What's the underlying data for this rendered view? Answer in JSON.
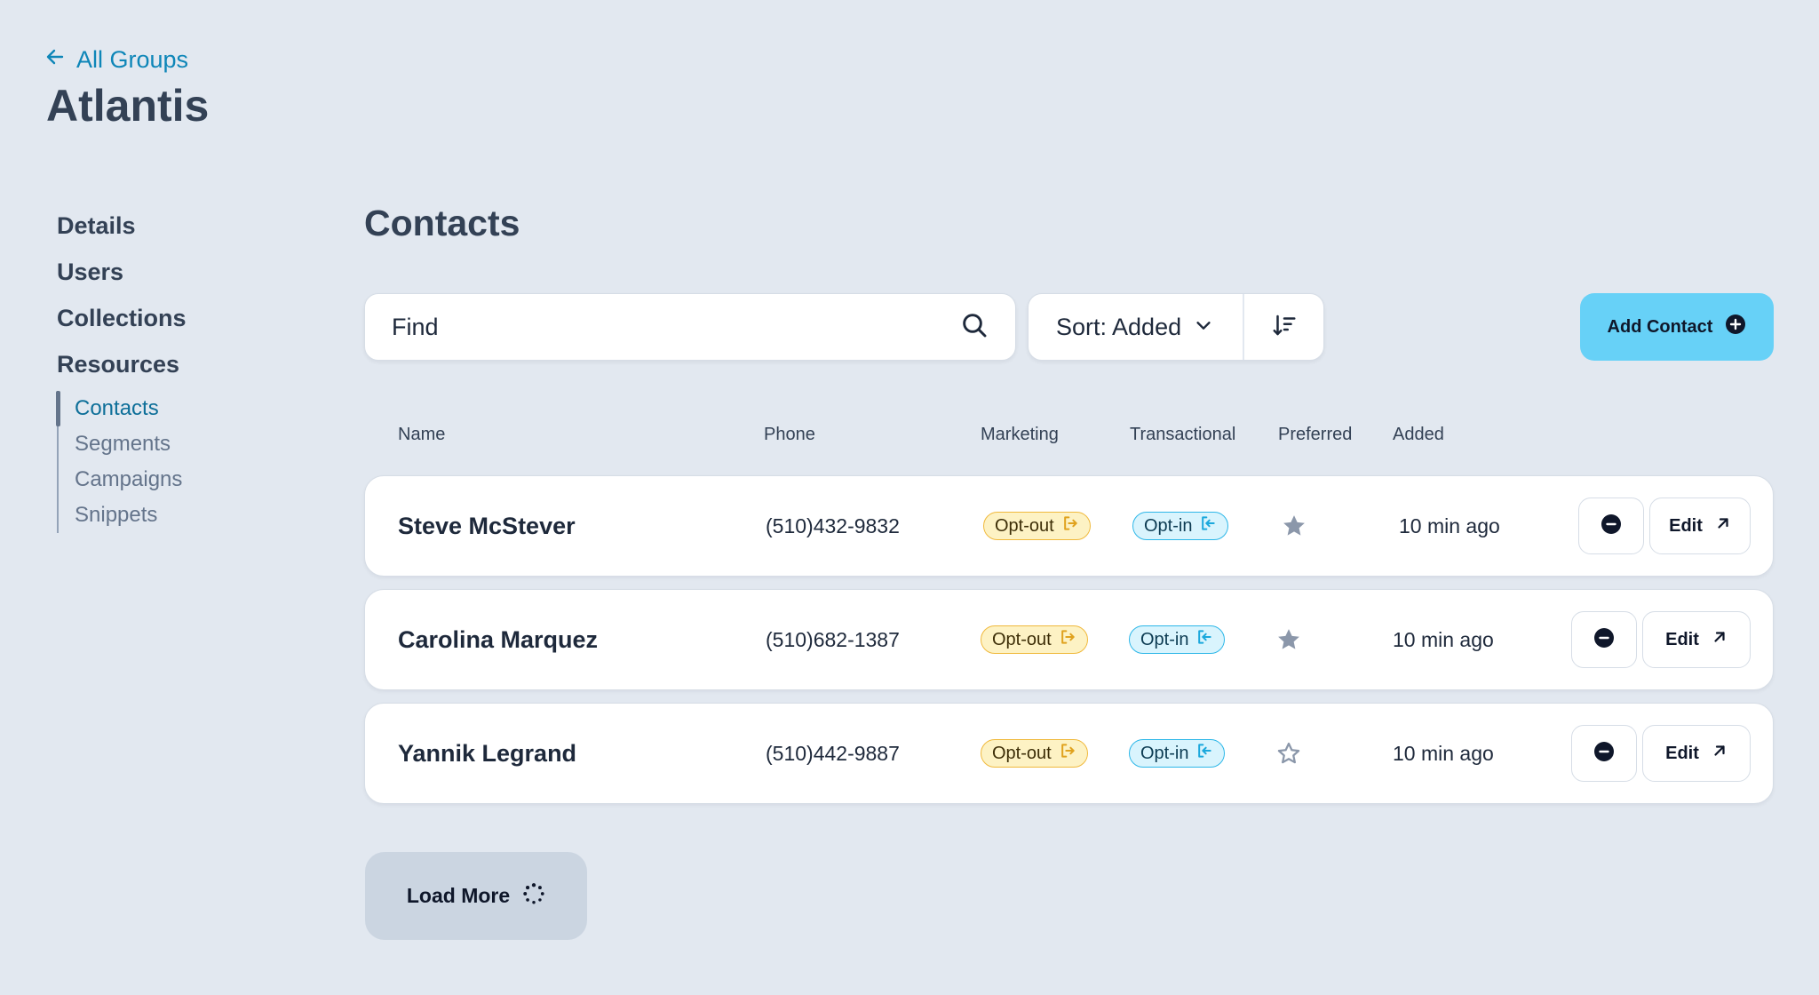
{
  "header": {
    "back_label": "All Groups",
    "group_title": "Atlantis"
  },
  "sidebar": {
    "items": [
      {
        "label": "Details"
      },
      {
        "label": "Users"
      },
      {
        "label": "Collections"
      },
      {
        "label": "Resources"
      }
    ],
    "sub_items": [
      {
        "label": "Contacts",
        "active": true
      },
      {
        "label": "Segments",
        "active": false
      },
      {
        "label": "Campaigns",
        "active": false
      },
      {
        "label": "Snippets",
        "active": false
      }
    ]
  },
  "main": {
    "title": "Contacts",
    "search": {
      "placeholder": "Find",
      "value": ""
    },
    "sort_label": "Sort: Added",
    "add_button_label": "Add Contact",
    "columns": [
      "Name",
      "Phone",
      "Marketing",
      "Transactional",
      "Preferred",
      "Added"
    ],
    "rows": [
      {
        "name": "Steve McStever",
        "phone": "(510)432-9832",
        "marketing": "Opt-out",
        "transactional": "Opt-in",
        "preferred": true,
        "added": "10 min ago",
        "edit_label": "Edit"
      },
      {
        "name": "Carolina Marquez",
        "phone": "(510)682-1387",
        "marketing": "Opt-out",
        "transactional": "Opt-in",
        "preferred": true,
        "added": "10 min ago",
        "edit_label": "Edit"
      },
      {
        "name": "Yannik Legrand",
        "phone": "(510)442-9887",
        "marketing": "Opt-out",
        "transactional": "Opt-in",
        "preferred": false,
        "added": "10 min ago",
        "edit_label": "Edit"
      }
    ],
    "load_more_label": "Load More"
  },
  "icons": {
    "back": "arrow-left-icon",
    "search": "search-icon",
    "sort_open": "chevron-down-icon",
    "sort_direction": "sort-descending-icon",
    "add": "plus-circle-icon",
    "opt_out": "opt-out-icon",
    "opt_in": "opt-in-icon",
    "preferred": "star-icon",
    "remove": "minus-circle-icon",
    "edit": "arrow-up-right-icon",
    "loading": "spinner-icon"
  },
  "colors": {
    "background": "#e2e8f0",
    "accent_link": "#0e86b8",
    "primary_button": "#67d1f7",
    "opt_out_bg": "#fdf2c4",
    "opt_out_border": "#f0b93c",
    "opt_in_bg": "#d9f4fd",
    "opt_in_border": "#2db7e8",
    "star_filled": "#8b97aa"
  }
}
